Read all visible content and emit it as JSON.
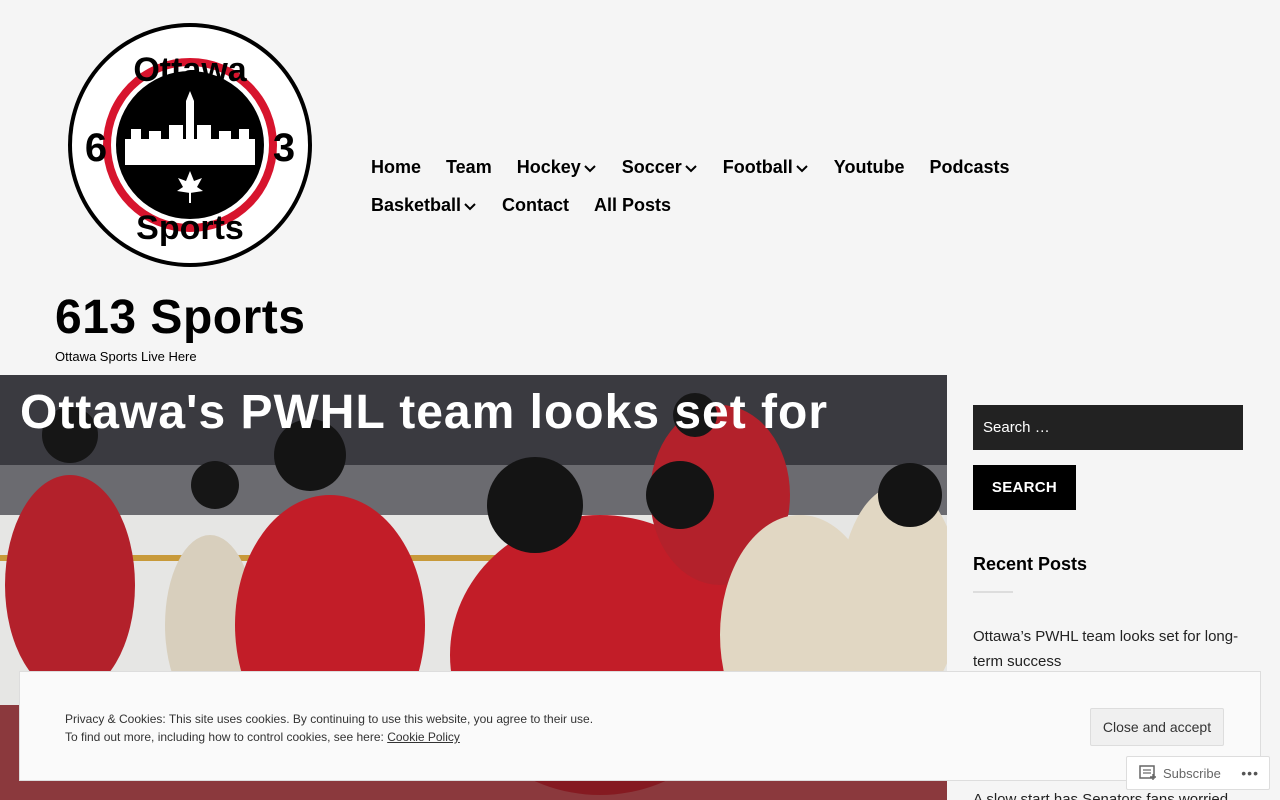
{
  "logo": {
    "top_text": "Ottawa",
    "bottom_text": "Sports",
    "left_digit": "6",
    "right_digit": "3"
  },
  "nav": {
    "row1": [
      {
        "label": "Home",
        "dropdown": false
      },
      {
        "label": "Team",
        "dropdown": false
      },
      {
        "label": "Hockey",
        "dropdown": true
      },
      {
        "label": "Soccer",
        "dropdown": true
      },
      {
        "label": "Football",
        "dropdown": true
      },
      {
        "label": "Youtube",
        "dropdown": false
      },
      {
        "label": "Podcasts",
        "dropdown": false
      }
    ],
    "row2": [
      {
        "label": "Basketball",
        "dropdown": true
      },
      {
        "label": "Contact",
        "dropdown": false
      },
      {
        "label": "All Posts",
        "dropdown": false
      }
    ]
  },
  "site": {
    "title": "613 Sports",
    "tagline": "Ottawa Sports Live Here"
  },
  "hero": {
    "title": "Ottawa's PWHL team looks set for"
  },
  "sidebar": {
    "search_placeholder": "Search …",
    "search_button": "SEARCH",
    "recent_heading": "Recent Posts",
    "recent_posts": [
      "Ottawa’s PWHL team looks set for long-term success",
      "A slow start has Senators fans worried"
    ]
  },
  "cookie_banner": {
    "line1": "Privacy & Cookies: This site uses cookies. By continuing to use this website, you agree to their use.",
    "line2": "To find out more, including how to control cookies, see here:",
    "link": "Cookie Policy",
    "button": "Close and accept"
  },
  "subscribe": {
    "label": "Subscribe",
    "more": "•••"
  },
  "colors": {
    "accent_red": "#d7142d",
    "black": "#000000",
    "search_bg": "#222222"
  }
}
